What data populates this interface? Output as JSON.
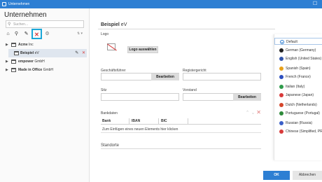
{
  "window": {
    "title": "Unternehmen",
    "close_glyph": "☐"
  },
  "sidebar": {
    "title": "Unternehmen",
    "search_placeholder": "Suchen...",
    "toolbar": {
      "add_company_glyph": "⌂",
      "link_glyph": "⚲",
      "edit_glyph": "✎",
      "delete_glyph": "✕",
      "gear_glyph": "⚙",
      "sort_glyph": "⇅ ▾"
    },
    "tree": [
      {
        "label": "Acme",
        "suffix": " Inc",
        "expanded": false
      },
      {
        "label": "Beispiel",
        "suffix": " eV",
        "selected": true,
        "edit_glyph": "✎",
        "delete_glyph": "✕"
      },
      {
        "label": "empower",
        "suffix": " GmbH",
        "expanded": false
      },
      {
        "label": "Made in Office",
        "suffix": " GmbH",
        "expanded": false
      }
    ]
  },
  "main": {
    "title_bold": "Beispiel",
    "title_rest": " eV",
    "logo_label": "Logo",
    "logo_button": "Logo auswählen",
    "managing_director_label": "Geschäftsführer",
    "managing_director_button": "Bearbeiten",
    "registry_court_label": "Registergericht",
    "registry_court_value": "",
    "seat_label": "Sitz",
    "seat_value": "",
    "board_label": "Vorstand",
    "board_button": "Bearbeiten",
    "bank": {
      "label": "Bankdaten",
      "columns": [
        "Bank",
        "IBAN",
        "BIC"
      ],
      "add_row": "Zum Einfügen eines neuen Elements hier klicken",
      "controls": {
        "up": "⌃",
        "down": "⌄",
        "remove": "✕"
      }
    },
    "locations_label": "Standorte"
  },
  "languages": [
    {
      "label": "Default",
      "color": "#2d7fd3",
      "selected": true
    },
    {
      "label": "German (Germany)",
      "color": "#222222"
    },
    {
      "label": "English (United States)",
      "color": "#3355aa"
    },
    {
      "label": "Spanish (Spain)",
      "color": "#e8a11a"
    },
    {
      "label": "French (France)",
      "color": "#2d4fbf"
    },
    {
      "label": "Italian (Italy)",
      "color": "#2e9b4a"
    },
    {
      "label": "Japanese (Japan)",
      "color": "#d83a3a"
    },
    {
      "label": "Dutch (Netherlands)",
      "color": "#d4452a"
    },
    {
      "label": "Portuguese (Portugal)",
      "color": "#2e8a3a"
    },
    {
      "label": "Russian (Russia)",
      "color": "#3a5fc8"
    },
    {
      "label": "Chinese (Simplified, PRC)",
      "color": "#d83a3a"
    }
  ],
  "footer": {
    "ok": "OK",
    "cancel": "Abbrechen"
  }
}
